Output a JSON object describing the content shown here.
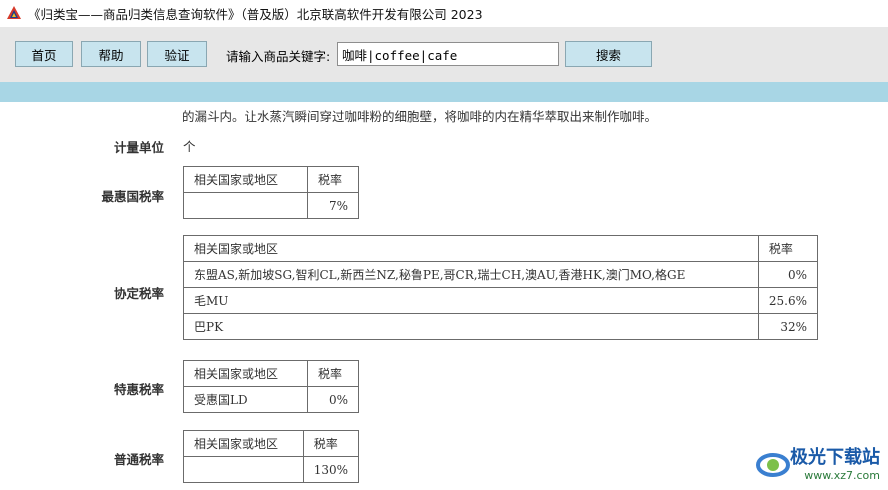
{
  "window": {
    "title": "《归类宝——商品归类信息查询软件》（普及版）北京联高软件开发有限公司 2023"
  },
  "toolbar": {
    "home_label": "首页",
    "help_label": "帮助",
    "verify_label": "验证",
    "keyword_label": "请输入商品关键字:",
    "keyword_value": "咖啡|coffee|cafe",
    "search_label": "搜索"
  },
  "content": {
    "description_tail": "的漏斗内。让水蒸汽瞬间穿过咖啡粉的细胞壁，将咖啡的内在精华萃取出来制作咖啡。",
    "unit": {
      "label": "计量单位",
      "value": "个"
    },
    "mfn": {
      "label": "最惠国税率",
      "header_region": "相关国家或地区",
      "header_rate": "税率",
      "rows": [
        {
          "region": "",
          "rate": "7%"
        }
      ]
    },
    "agreement": {
      "label": "协定税率",
      "header_region": "相关国家或地区",
      "header_rate": "税率",
      "rows": [
        {
          "region": "东盟AS,新加坡SG,智利CL,新西兰NZ,秘鲁PE,哥CR,瑞士CH,澳AU,香港HK,澳门MO,格GE",
          "rate": "0%"
        },
        {
          "region": "毛MU",
          "rate": "25.6%"
        },
        {
          "region": "巴PK",
          "rate": "32%"
        }
      ]
    },
    "special": {
      "label": "特惠税率",
      "header_region": "相关国家或地区",
      "header_rate": "税率",
      "rows": [
        {
          "region": "受惠国LD",
          "rate": "0%"
        }
      ]
    },
    "general": {
      "label": "普通税率",
      "header_region": "相关国家或地区",
      "header_rate": "税率",
      "rows": [
        {
          "region": "",
          "rate": "130%"
        }
      ]
    }
  },
  "watermark": {
    "text": "极光下载站",
    "url": "www.xz7.com"
  }
}
